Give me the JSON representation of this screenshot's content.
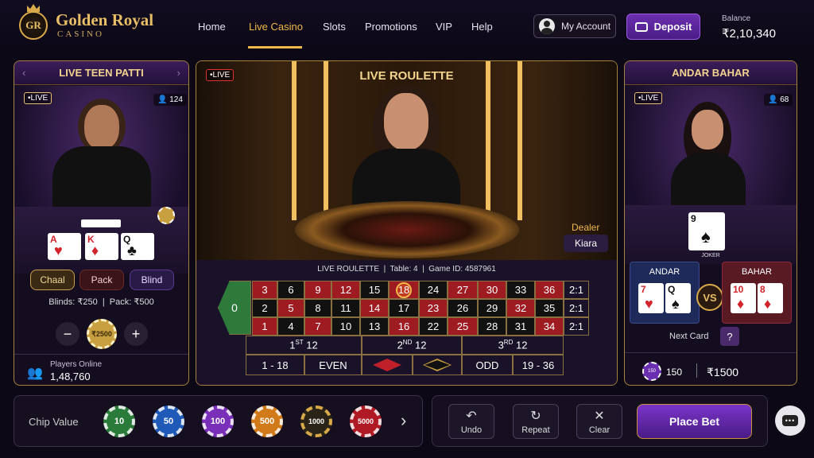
{
  "brand": {
    "monogram": "GR",
    "name": "Golden Royal",
    "sub": "CASINO"
  },
  "nav": [
    "Home",
    "Live Casino",
    "Slots",
    "Promotions",
    "VIP",
    "Help"
  ],
  "account_label": "My Account",
  "deposit_label": "Deposit",
  "balance": {
    "label": "Balance",
    "value": "₹2,10,340"
  },
  "teen_patti": {
    "title": "LIVE TEEN PATTI",
    "live": "•LIVE",
    "players": "124",
    "cards": [
      {
        "rank": "A",
        "suit": "♥"
      },
      {
        "rank": "K",
        "suit": "♦"
      },
      {
        "rank": "Q",
        "suit": "♣"
      }
    ],
    "actions": [
      "Chaal",
      "Pack",
      "Blind"
    ],
    "blinds": "Blinds: ₹250",
    "pack": "Pack: ₹500",
    "bet_chip": "₹2500",
    "online_label": "Players Online",
    "online_value": "1,48,760"
  },
  "roulette": {
    "live": "•LIVE",
    "title": "LIVE ROULETTE",
    "dealer_label": "Dealer",
    "dealer_name": "Kiara",
    "info": "LIVE ROULETTE  |  Table: 4  |  Game ID: 4587961",
    "zero": "0",
    "rows": [
      [
        "3",
        "6",
        "9",
        "12",
        "15",
        "18",
        "24",
        "27",
        "30",
        "33",
        "36",
        "2:1"
      ],
      [
        "2",
        "5",
        "8",
        "11",
        "14",
        "17",
        "23",
        "26",
        "29",
        "32",
        "35",
        "2:1"
      ],
      [
        "1",
        "4",
        "7",
        "10",
        "13",
        "16",
        "22",
        "25",
        "28",
        "31",
        "34",
        "2:1"
      ]
    ],
    "highlight": "18",
    "dozens": [
      "1ST 12",
      "2ND 12",
      "3RD 12"
    ],
    "outside": [
      "1 - 18",
      "EVEN",
      "ODD",
      "19 - 36"
    ]
  },
  "andar_bahar": {
    "title": "ANDAR BAHAR",
    "live": "•LIVE",
    "players": "68",
    "joker_card": {
      "rank": "9",
      "suit": "♠"
    },
    "joker_label": "JOKER",
    "andar_label": "ANDAR",
    "bahar_label": "BAHAR",
    "vs": "VS",
    "andar_cards": [
      {
        "rank": "7",
        "suit": "♥"
      },
      {
        "rank": "Q",
        "suit": "♠"
      }
    ],
    "bahar_cards": [
      {
        "rank": "10",
        "suit": "♦"
      },
      {
        "rank": "8",
        "suit": "♦"
      }
    ],
    "next_card_label": "Next Card",
    "next_card_value": "?",
    "chip_label": "150",
    "count": "150",
    "amount": "₹1500"
  },
  "chip_bar": {
    "label": "Chip Value",
    "chips": [
      "10",
      "50",
      "100",
      "500",
      "1000",
      "5000"
    ],
    "next": "›"
  },
  "controls": {
    "undo": "Undo",
    "repeat": "Repeat",
    "clear": "Clear",
    "place_bet": "Place Bet"
  },
  "colors": {
    "gold": "#e7be66",
    "purple": "#6c2fb0",
    "red": "#9e1b22",
    "green": "#2e7a3a"
  }
}
